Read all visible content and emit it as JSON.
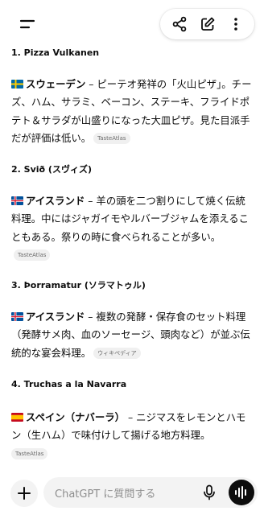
{
  "topbar": {
    "menu_icon": "menu-icon",
    "actions": [
      "share-icon",
      "edit-icon",
      "more-vertical-icon"
    ]
  },
  "items": [
    {
      "heading": "1. Pizza Vulkanen",
      "flag": "sweden-flag",
      "country": "スウェーデン",
      "text": " – ピーテオ発祥の「火山ピザ」。チーズ、ハム、サラミ、ベーコン、ステーキ、フライドポテト＆サラダが山盛りになった大皿ピザ。見た目派手だが評価は低い。",
      "source": "TasteAtlas"
    },
    {
      "heading": "2. Svið (スヴィズ)",
      "flag": "iceland-flag",
      "country": "アイスランド",
      "text": " – 羊の頭を二つ割りにして焼く伝統料理。中にはジャガイモやルバーブジャムを添えることもある。祭りの時に食べられることが多い。",
      "source": "TasteAtlas"
    },
    {
      "heading": "3. Þorramatur (ソラマトゥル)",
      "flag": "iceland-flag",
      "country": "アイスランド",
      "text": " – 複数の発酵・保存食のセット料理（発酵サメ肉、血のソーセージ、頭肉など）が並ぶ伝統的な宴会料理。",
      "source": "ウィキペディア"
    },
    {
      "heading": "4. Truchas a la Navarra",
      "flag": "spain-flag",
      "country": "スペイン（ナバーラ）",
      "text": " – ニジマスをレモンとハモン（生ハム）で味付けして揚げる地方料理。",
      "source": "TasteAtlas"
    }
  ],
  "composer": {
    "placeholder": "ChatGPT に質問する",
    "plus_icon": "plus-icon",
    "mic_icon": "mic-icon",
    "voice_icon": "voice-mode-icon"
  },
  "colors": {
    "text": "#0d0d0d",
    "chip_bg": "#f0f0f0",
    "input_bg": "#f3f3f3"
  }
}
